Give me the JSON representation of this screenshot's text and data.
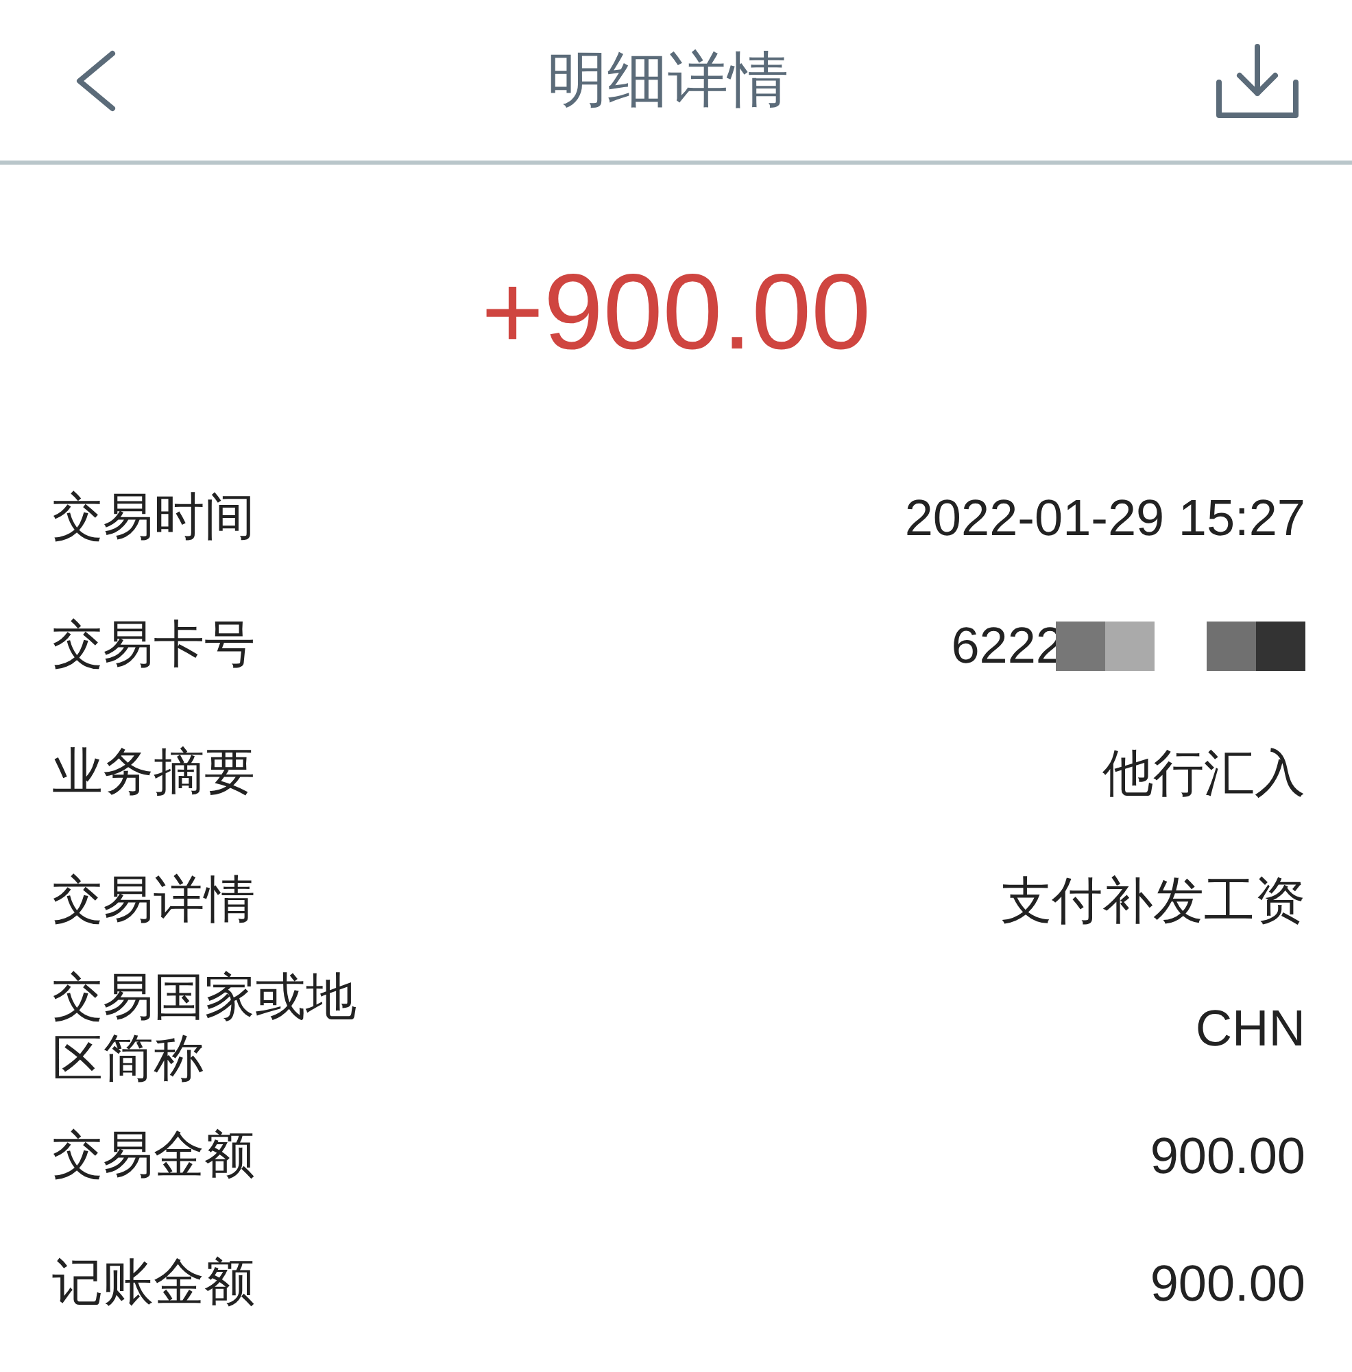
{
  "header": {
    "title": "明细详情"
  },
  "amount": {
    "text": "+900.00"
  },
  "details": [
    {
      "kind": "text",
      "label": "交易时间",
      "value": "2022-01-29 15:27"
    },
    {
      "kind": "masked",
      "label": "交易卡号",
      "value": "6222"
    },
    {
      "kind": "text",
      "label": "业务摘要",
      "value": "他行汇入"
    },
    {
      "kind": "text",
      "label": "交易详情",
      "value": "支付补发工资"
    },
    {
      "kind": "text",
      "label": "交易国家或地区简称",
      "value": "CHN"
    },
    {
      "kind": "text",
      "label": "交易金额",
      "value": "900.00"
    },
    {
      "kind": "text",
      "label": "记账金额",
      "value": "900.00"
    }
  ]
}
